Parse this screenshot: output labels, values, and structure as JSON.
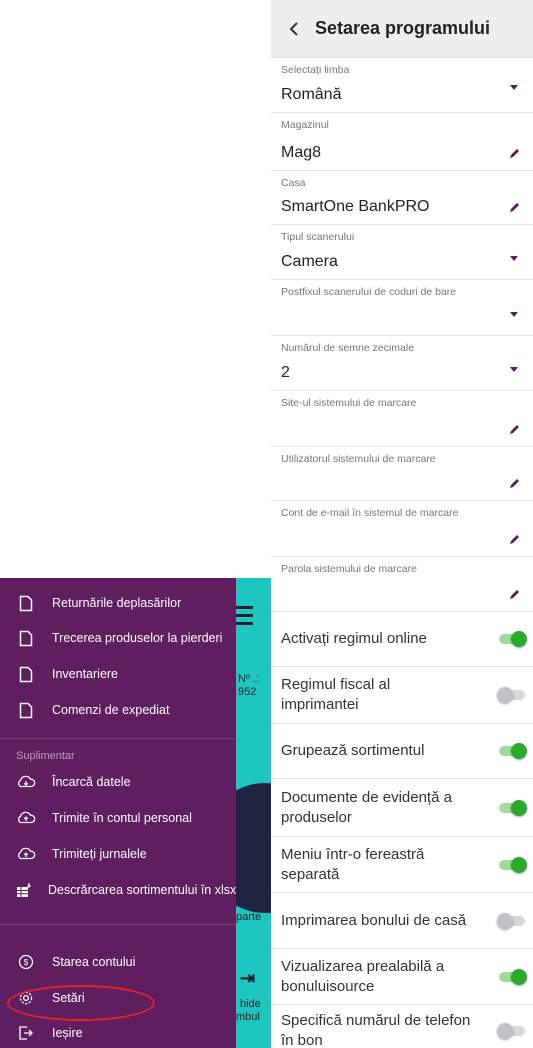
{
  "settings": {
    "title": "Setarea programului",
    "fields": [
      {
        "label": "Selectați limba",
        "value": "Română",
        "control": "dropdown"
      },
      {
        "label": "Magazinul",
        "value": "Mag8",
        "control": "edit"
      },
      {
        "label": "Casa",
        "value": "SmartOne BankPRO",
        "control": "edit"
      },
      {
        "label": "Tipul scanerului",
        "value": "Camera",
        "control": "dropdown"
      },
      {
        "label": "Postfixul scanerului de coduri de bare",
        "value": "",
        "control": "dropdown"
      },
      {
        "label": "Numărul de semne zecimale",
        "value": "2",
        "control": "dropdown"
      },
      {
        "label": "Site-ul sistemului de marcare",
        "value": "",
        "control": "edit"
      },
      {
        "label": "Utilizatorul sistemului de marcare",
        "value": "",
        "control": "edit"
      },
      {
        "label": "Cont de e-mail în sistemul de marcare",
        "value": "",
        "control": "edit"
      },
      {
        "label": "Parola sistemului de marcare",
        "value": "",
        "control": "edit"
      }
    ],
    "toggles": [
      {
        "label": "Activați regimul online",
        "on": true
      },
      {
        "label": "Regimul fiscal al imprimantei",
        "on": false
      },
      {
        "label": "Grupează sortimentul",
        "on": true
      },
      {
        "label": "Documente de evidență a produselor",
        "on": true
      },
      {
        "label": "Meniu într-o fereastră separată",
        "on": true
      },
      {
        "label": "Imprimarea bonului de casă",
        "on": false
      },
      {
        "label": "Vizualizarea prealabilă a bonuluisource",
        "on": true
      },
      {
        "label": "Specifică numărul de telefon în bon",
        "on": false
      }
    ],
    "colors": {
      "toggle_on": "#2aaa2a",
      "toggle_off": "#bfc3c8",
      "accent": "#5a1a5c"
    }
  },
  "drawer": {
    "items_top": [
      {
        "label": "Returnările deplasărilor",
        "icon": "document-icon"
      },
      {
        "label": "Trecerea produselor la pierderi",
        "icon": "document-icon"
      },
      {
        "label": "Inventariere",
        "icon": "document-icon"
      },
      {
        "label": "Comenzi de expediat",
        "icon": "document-icon"
      }
    ],
    "section_header": "Suplimentar",
    "items_extra": [
      {
        "label": "Încarcă datele",
        "icon": "cloud-download-icon"
      },
      {
        "label": "Trimite în contul personal",
        "icon": "cloud-upload-icon"
      },
      {
        "label": "Trimiteți jurnalele",
        "icon": "cloud-upload-icon"
      },
      {
        "label": "Descrărcarea sortimentului în xlsx",
        "icon": "spreadsheet-icon"
      }
    ],
    "items_bottom": [
      {
        "label": "Starea contului",
        "icon": "account-icon"
      },
      {
        "label": "Setări",
        "icon": "gear-icon"
      },
      {
        "label": "Ieșire",
        "icon": "exit-icon"
      }
    ],
    "colors": {
      "background": "#5e1e60",
      "app_background": "#1ec6c1"
    }
  },
  "app_peek": {
    "number_label": "Nº .:",
    "number_value": "952",
    "button1": "parte",
    "button2_line1": "hide",
    "button2_line2": "mbul"
  }
}
